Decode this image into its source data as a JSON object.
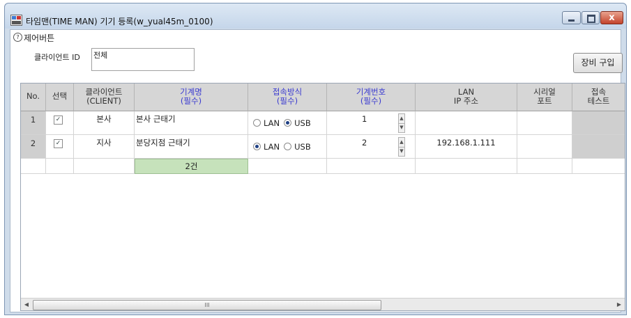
{
  "window": {
    "title": "타임맨(TIME MAN) 기기 등록(w_yual45m_0100)",
    "close_symbol": "x"
  },
  "toolbar": {
    "section_label": "제어버튼",
    "client_id_label": "클라이언트 ID",
    "client_id_value": "전체",
    "buy_button": "장비 구입"
  },
  "grid": {
    "headers": [
      {
        "line1": "No.",
        "line2": ""
      },
      {
        "line1": "선택",
        "line2": ""
      },
      {
        "line1": "클라이언트",
        "line2": "(CLIENT)"
      },
      {
        "line1": "기계명",
        "line2": "(필수)"
      },
      {
        "line1": "접속방식",
        "line2": "(필수)"
      },
      {
        "line1": "기계번호",
        "line2": "(필수)"
      },
      {
        "line1": "LAN",
        "line2": "IP 주소"
      },
      {
        "line1": "시리얼",
        "line2": "포트"
      },
      {
        "line1": "접속",
        "line2": "테스트"
      }
    ],
    "rows": [
      {
        "no": "1",
        "selected": true,
        "client": "본사",
        "machine_name": "본사 근태기",
        "connection": "USB",
        "lan_label": "LAN",
        "usb_label": "USB",
        "machine_no": "1",
        "lan_ip": ""
      },
      {
        "no": "2",
        "selected": true,
        "client": "지사",
        "machine_name": "분당지점 근태기",
        "connection": "LAN",
        "lan_label": "LAN",
        "usb_label": "USB",
        "machine_no": "2",
        "lan_ip": "192.168.1.111"
      }
    ],
    "count_text": "2건"
  },
  "scrollbar": {
    "grip": "III",
    "left_arrow": "◀",
    "right_arrow": "▶"
  }
}
